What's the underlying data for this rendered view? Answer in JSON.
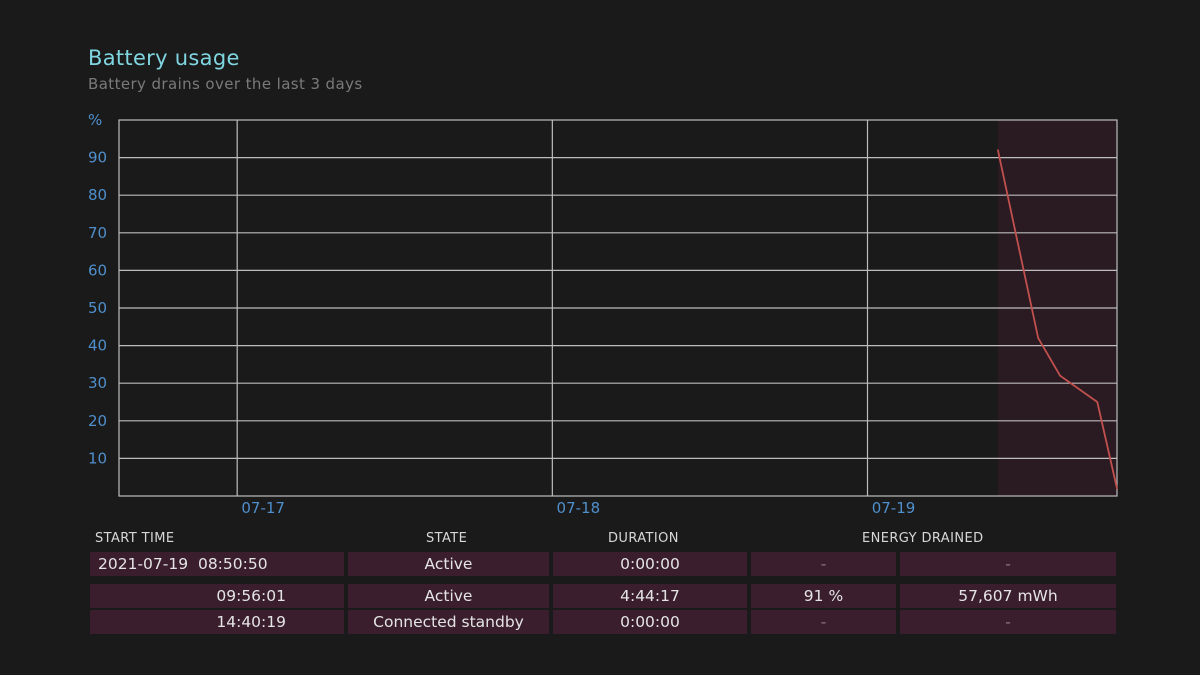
{
  "header": {
    "title": "Battery usage",
    "subtitle": "Battery drains over the last 3 days"
  },
  "chart_data": {
    "type": "line",
    "title": "Battery usage",
    "subtitle": "Battery drains over the last 3 days",
    "ylabel": "%",
    "ylim": [
      0,
      100
    ],
    "yticks": [
      10,
      20,
      30,
      40,
      50,
      60,
      70,
      80,
      90
    ],
    "xlim": [
      "2021-07-16 15:00",
      "2021-07-19 19:00"
    ],
    "x_tick_labels": [
      {
        "label": "07-17",
        "at": "2021-07-17 00:00"
      },
      {
        "label": "07-18",
        "at": "2021-07-18 00:00"
      },
      {
        "label": "07-19",
        "at": "2021-07-19 00:00"
      }
    ],
    "grid": true,
    "legend": "none",
    "highlight_region": {
      "from": "2021-07-19 09:56",
      "to": "2021-07-19 19:00",
      "color": "#2a1a22"
    },
    "series": [
      {
        "color": "#c0504d",
        "points": [
          {
            "x": "2021-07-19 09:56",
            "y": 92
          },
          {
            "x": "2021-07-19 13:00",
            "y": 42
          },
          {
            "x": "2021-07-19 14:40",
            "y": 32
          },
          {
            "x": "2021-07-19 17:30",
            "y": 25
          },
          {
            "x": "2021-07-19 19:00",
            "y": 2
          }
        ]
      }
    ]
  },
  "table": {
    "headers": [
      "START TIME",
      "STATE",
      "DURATION",
      "ENERGY DRAINED"
    ],
    "rows": [
      {
        "date": "2021-07-19",
        "time": "08:50:50",
        "state": "Active",
        "duration": "0:00:00",
        "energy_pct": "-",
        "energy_mwh": "-"
      },
      {
        "date": "",
        "time": "09:56:01",
        "state": "Active",
        "duration": "4:44:17",
        "energy_pct": "91 %",
        "energy_mwh": "57,607 mWh"
      },
      {
        "date": "",
        "time": "14:40:19",
        "state": "Connected standby",
        "duration": "0:00:00",
        "energy_pct": "-",
        "energy_mwh": "-"
      }
    ]
  }
}
